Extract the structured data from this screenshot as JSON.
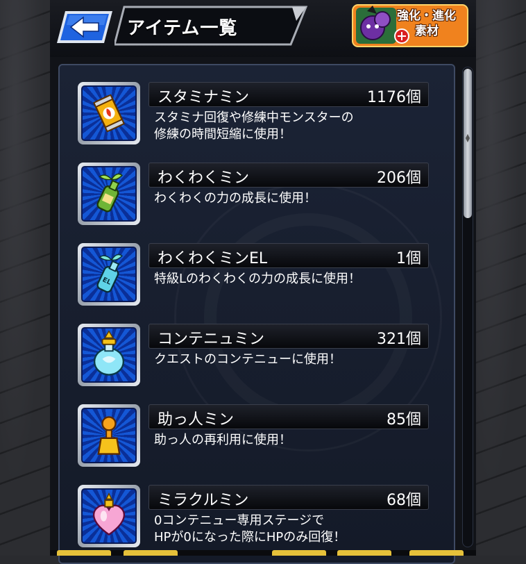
{
  "header": {
    "title": "アイテム一覧",
    "back_icon": "back-arrow-icon",
    "material_button": {
      "line1": "強化・進化",
      "line2": "素材",
      "icon": "material-monster-icon"
    }
  },
  "items": [
    {
      "name": "スタミナミン",
      "count": "1176個",
      "description": "スタミナ回復や修練中モンスターの\n修練の時間短縮に使用！",
      "icon": "stamina-can-icon"
    },
    {
      "name": "わくわくミン",
      "count": "206個",
      "description": "わくわくの力の成長に使用！",
      "icon": "sprout-bottle-icon"
    },
    {
      "name": "わくわくミンEL",
      "count": "1個",
      "description": "特級Lのわくわくの力の成長に使用！",
      "icon": "el-bottle-icon"
    },
    {
      "name": "コンテニュミン",
      "count": "321個",
      "description": "クエストのコンテニューに使用！",
      "icon": "continue-flask-icon"
    },
    {
      "name": "助っ人ミン",
      "count": "85個",
      "description": "助っ人の再利用に使用！",
      "icon": "helper-figure-icon"
    },
    {
      "name": "ミラクルミン",
      "count": "68個",
      "description": "0コンテニュー専用ステージで\nHPが0になった際にHPのみ回復！",
      "icon": "miracle-heart-icon"
    }
  ],
  "colors": {
    "panel": "#1b2335",
    "icon_blue": "#1457d6",
    "material_orange": "#f0821e"
  }
}
